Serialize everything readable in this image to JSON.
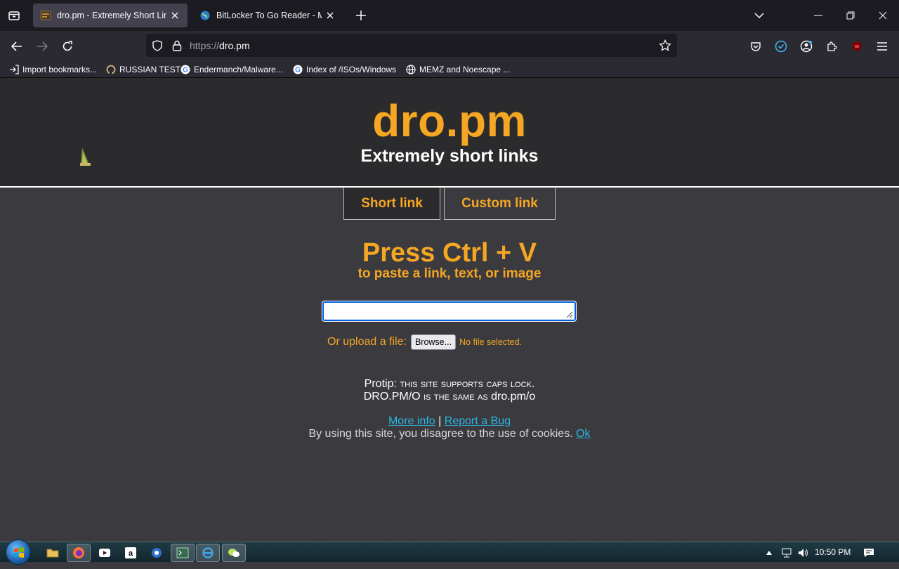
{
  "browser": {
    "tabs": [
      {
        "title": "dro.pm - Extremely Short Links",
        "active": true
      },
      {
        "title": "BitLocker To Go Reader - Micro",
        "active": false
      }
    ],
    "url_protocol": "https://",
    "url_host": "dro.pm",
    "bookmarks": [
      {
        "label": "Import bookmarks...",
        "icon": "import-icon"
      },
      {
        "label": "RUSSIAN TEST",
        "icon": "site-icon"
      },
      {
        "label": "Endermanch/Malware...",
        "icon": "google-icon"
      },
      {
        "label": "Index of /ISOs/Windows",
        "icon": "google-icon"
      },
      {
        "label": "MEMZ and Noescape ...",
        "icon": "globe-icon"
      }
    ]
  },
  "page": {
    "logo": "dro.pm",
    "tagline": "Extremely short links",
    "mode_tabs": [
      "Short link",
      "Custom link"
    ],
    "headline": "Press Ctrl + V",
    "subheadline": "to paste a link, text, or image",
    "paste_value": "",
    "upload_label": "Or upload a file:",
    "browse_label": "Browse...",
    "no_file_text": "No file selected.",
    "protip_prefix": "Protip:",
    "protip_line1": "this site supports caps lock.",
    "protip_line2_caps": "DRO.PM/O",
    "protip_line2_mid": "is the same as",
    "protip_line2_end": "dro.pm/o",
    "more_info": "More info",
    "separator": "|",
    "report_bug": "Report a Bug",
    "cookie_text": "By using this site, you disagree to the use of cookies.",
    "cookie_ok": "Ok",
    "accent_color": "#f5a623",
    "link_color": "#2bb6e3"
  },
  "taskbar": {
    "clock": "10:50 PM"
  }
}
